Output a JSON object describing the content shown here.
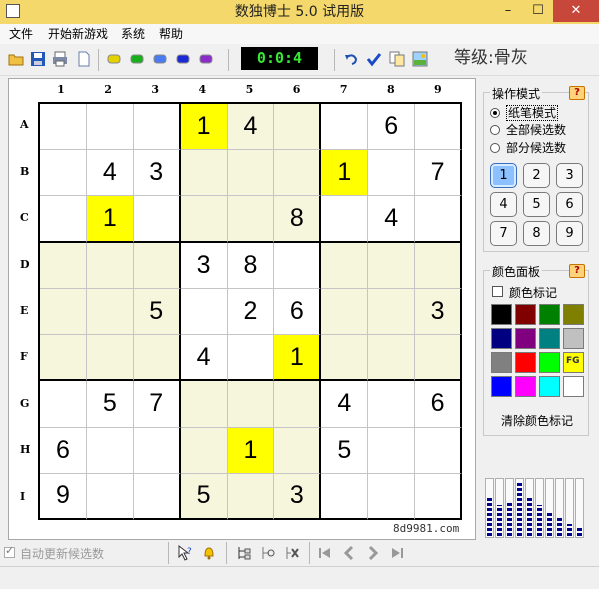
{
  "window": {
    "title": "数独博士 5.0 试用版"
  },
  "menu": [
    "文件",
    "开始新游戏",
    "系统",
    "帮助"
  ],
  "toolbar": {
    "timer": "0:0:4",
    "level_label": "等级:骨灰",
    "color_buttons": [
      {
        "name": "yellow-color-icon",
        "color": "#e5d000"
      },
      {
        "name": "green-color-icon",
        "color": "#18b01a"
      },
      {
        "name": "lightblue-color-icon",
        "color": "#4b7bf0"
      },
      {
        "name": "blue-color-icon",
        "color": "#1a2ad4"
      },
      {
        "name": "purple-color-icon",
        "color": "#8a2cc8"
      }
    ]
  },
  "board": {
    "col_labels": [
      "1",
      "2",
      "3",
      "4",
      "5",
      "6",
      "7",
      "8",
      "9"
    ],
    "row_labels": [
      "A",
      "B",
      "C",
      "D",
      "E",
      "F",
      "G",
      "H",
      "I"
    ],
    "cells": [
      [
        "",
        "",
        "",
        "1",
        "4",
        "",
        "",
        "6",
        ""
      ],
      [
        "",
        "4",
        "3",
        "",
        "",
        "",
        "1",
        "",
        "7"
      ],
      [
        "",
        "1",
        "",
        "",
        "",
        "8",
        "",
        "4",
        ""
      ],
      [
        "",
        "",
        "",
        "3",
        "8",
        "",
        "",
        "",
        ""
      ],
      [
        "",
        "",
        "5",
        "",
        "2",
        "6",
        "",
        "",
        "3"
      ],
      [
        "",
        "",
        "",
        "4",
        "",
        "1",
        "",
        "",
        ""
      ],
      [
        "",
        "5",
        "7",
        "",
        "",
        "",
        "4",
        "",
        "6"
      ],
      [
        "6",
        "",
        "",
        "",
        "1",
        "",
        "5",
        "",
        ""
      ],
      [
        "9",
        "",
        "",
        "5",
        "",
        "3",
        "",
        "",
        ""
      ]
    ],
    "highlighted_digit": "1",
    "watermark": "8d9981.com"
  },
  "mode_panel": {
    "title": "操作模式",
    "help": "?",
    "options": [
      "纸笔模式",
      "全部候选数",
      "部分候选数"
    ],
    "selected": 0,
    "digits": [
      "1",
      "2",
      "3",
      "4",
      "5",
      "6",
      "7",
      "8",
      "9"
    ],
    "active_digit": "1"
  },
  "color_panel": {
    "title": "颜色面板",
    "help": "?",
    "mark_label": "颜色标记",
    "swatches": [
      "#000000",
      "#800000",
      "#008000",
      "#808000",
      "#000080",
      "#800080",
      "#008080",
      "#c0c0c0",
      "#808080",
      "#ff0000",
      "#00ff00",
      "#ffff00",
      "#0000ff",
      "#ff00ff",
      "#00ffff",
      "#ffffff"
    ],
    "fg_label": "FG",
    "clear_label": "清除颜色标记"
  },
  "meter": {
    "levels": [
      0.72,
      0.55,
      0.62,
      0.95,
      0.72,
      0.55,
      0.45,
      0.35,
      0.22,
      0.15
    ]
  },
  "bottom": {
    "auto_update_label": "自动更新候选数"
  }
}
